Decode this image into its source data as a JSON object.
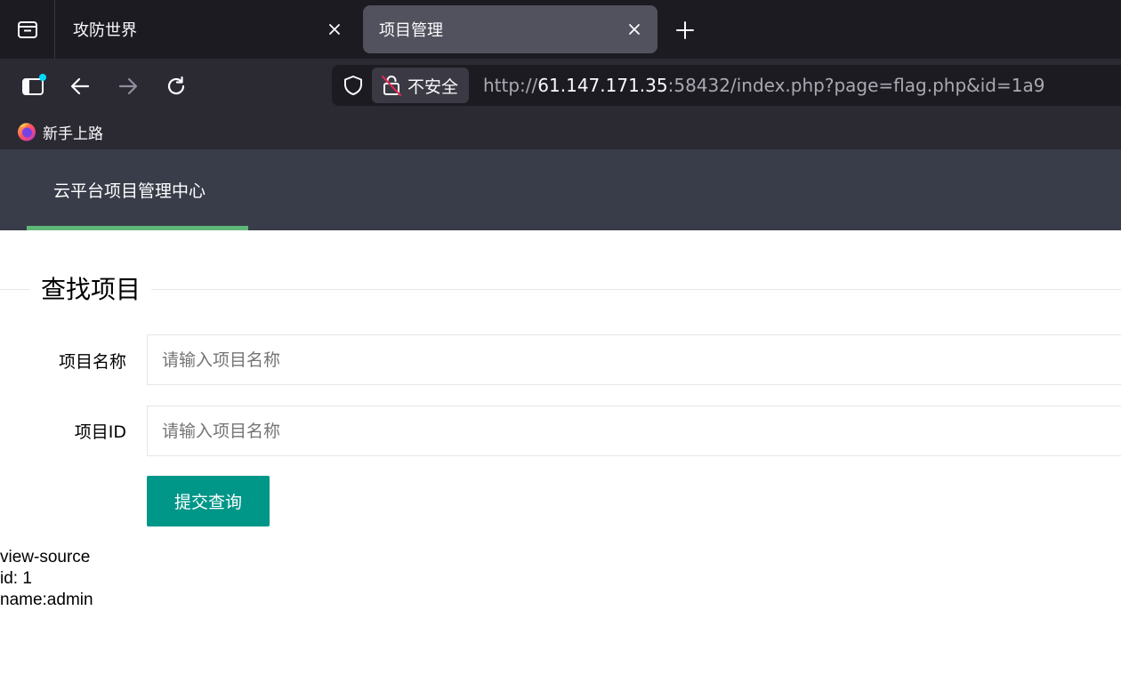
{
  "browser": {
    "tabs": [
      {
        "title": "攻防世界",
        "active": false
      },
      {
        "title": "项目管理",
        "active": true
      }
    ],
    "url": {
      "prefix": "http://",
      "host": "61.147.171.35",
      "rest": ":58432/index.php?page=flag.php&id=1a9"
    },
    "security_label": "不安全",
    "bookmarks": [
      {
        "label": "新手上路",
        "icon": "firefox-icon"
      }
    ]
  },
  "site": {
    "nav_title": "云平台项目管理中心",
    "nav_active_color": "#5fb878"
  },
  "form": {
    "legend": "查找项目",
    "fields": [
      {
        "label": "项目名称",
        "placeholder": "请输入项目名称",
        "value": ""
      },
      {
        "label": "项目ID",
        "placeholder": "请输入项目名称",
        "value": ""
      }
    ],
    "submit_label": "提交查询",
    "submit_color": "#009688"
  },
  "result": {
    "lines": [
      "view-source",
      "id: 1",
      "name:admin"
    ]
  }
}
